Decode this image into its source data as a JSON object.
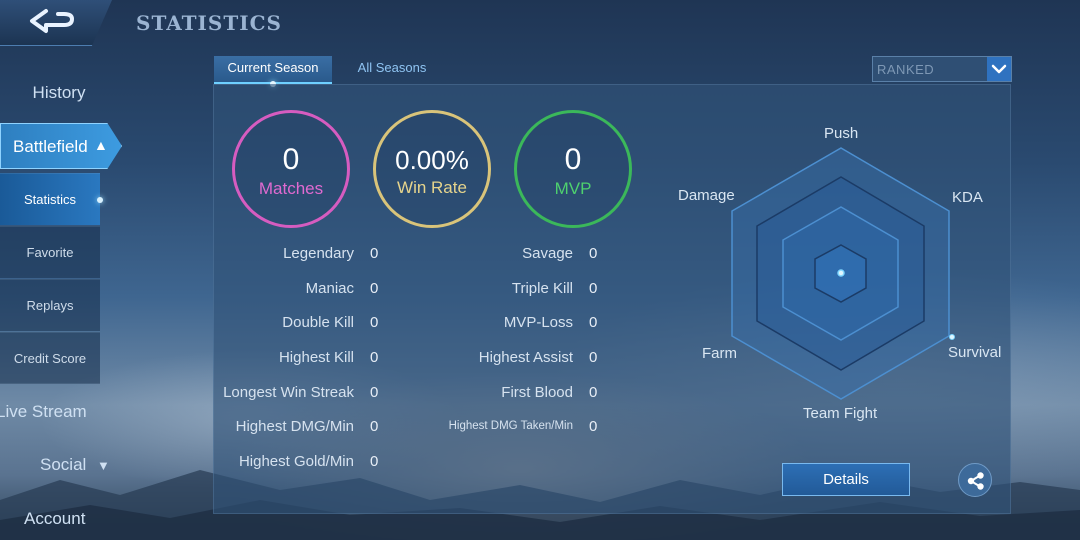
{
  "header": {
    "title": "STATISTICS"
  },
  "sidebar": {
    "items": [
      {
        "label": "History"
      },
      {
        "label": "Battlefield"
      },
      {
        "label": "Live Stream"
      },
      {
        "label": "Social"
      },
      {
        "label": "Account"
      }
    ],
    "sub_items": [
      {
        "label": "Statistics"
      },
      {
        "label": "Favorite"
      },
      {
        "label": "Replays"
      },
      {
        "label": "Credit Score"
      }
    ]
  },
  "tabs": [
    {
      "label": "Current Season"
    },
    {
      "label": "All Seasons"
    }
  ],
  "filter": {
    "selected": "RANKED"
  },
  "summary": {
    "matches": {
      "value": "0",
      "label": "Matches"
    },
    "win_rate": {
      "value": "0.00%",
      "label": "Win Rate"
    },
    "mvp": {
      "value": "0",
      "label": "MVP"
    }
  },
  "stats_left": [
    {
      "label": "Legendary",
      "value": "0"
    },
    {
      "label": "Maniac",
      "value": "0"
    },
    {
      "label": "Double Kill",
      "value": "0"
    },
    {
      "label": "Highest Kill",
      "value": "0"
    },
    {
      "label": "Longest Win Streak",
      "value": "0"
    },
    {
      "label": "Highest DMG/Min",
      "value": "0"
    },
    {
      "label": "Highest Gold/Min",
      "value": "0"
    }
  ],
  "stats_right": [
    {
      "label": "Savage",
      "value": "0"
    },
    {
      "label": "Triple Kill",
      "value": "0"
    },
    {
      "label": "MVP-Loss",
      "value": "0"
    },
    {
      "label": "Highest Assist",
      "value": "0"
    },
    {
      "label": "First Blood",
      "value": "0"
    },
    {
      "label": "Highest DMG Taken/Min",
      "value": "0"
    }
  ],
  "radar": {
    "axes": [
      "Push",
      "KDA",
      "Survival",
      "Team Fight",
      "Farm",
      "Damage"
    ]
  },
  "buttons": {
    "details": "Details"
  },
  "colors": {
    "matches_ring": "#d65cc0",
    "win_rate_ring": "#d9c47a",
    "mvp_ring": "#3bb85a",
    "accent": "#3d9be0"
  },
  "icons": {
    "back": "back-arrow-icon",
    "dropdown": "chevron-down-icon",
    "share": "share-icon"
  }
}
